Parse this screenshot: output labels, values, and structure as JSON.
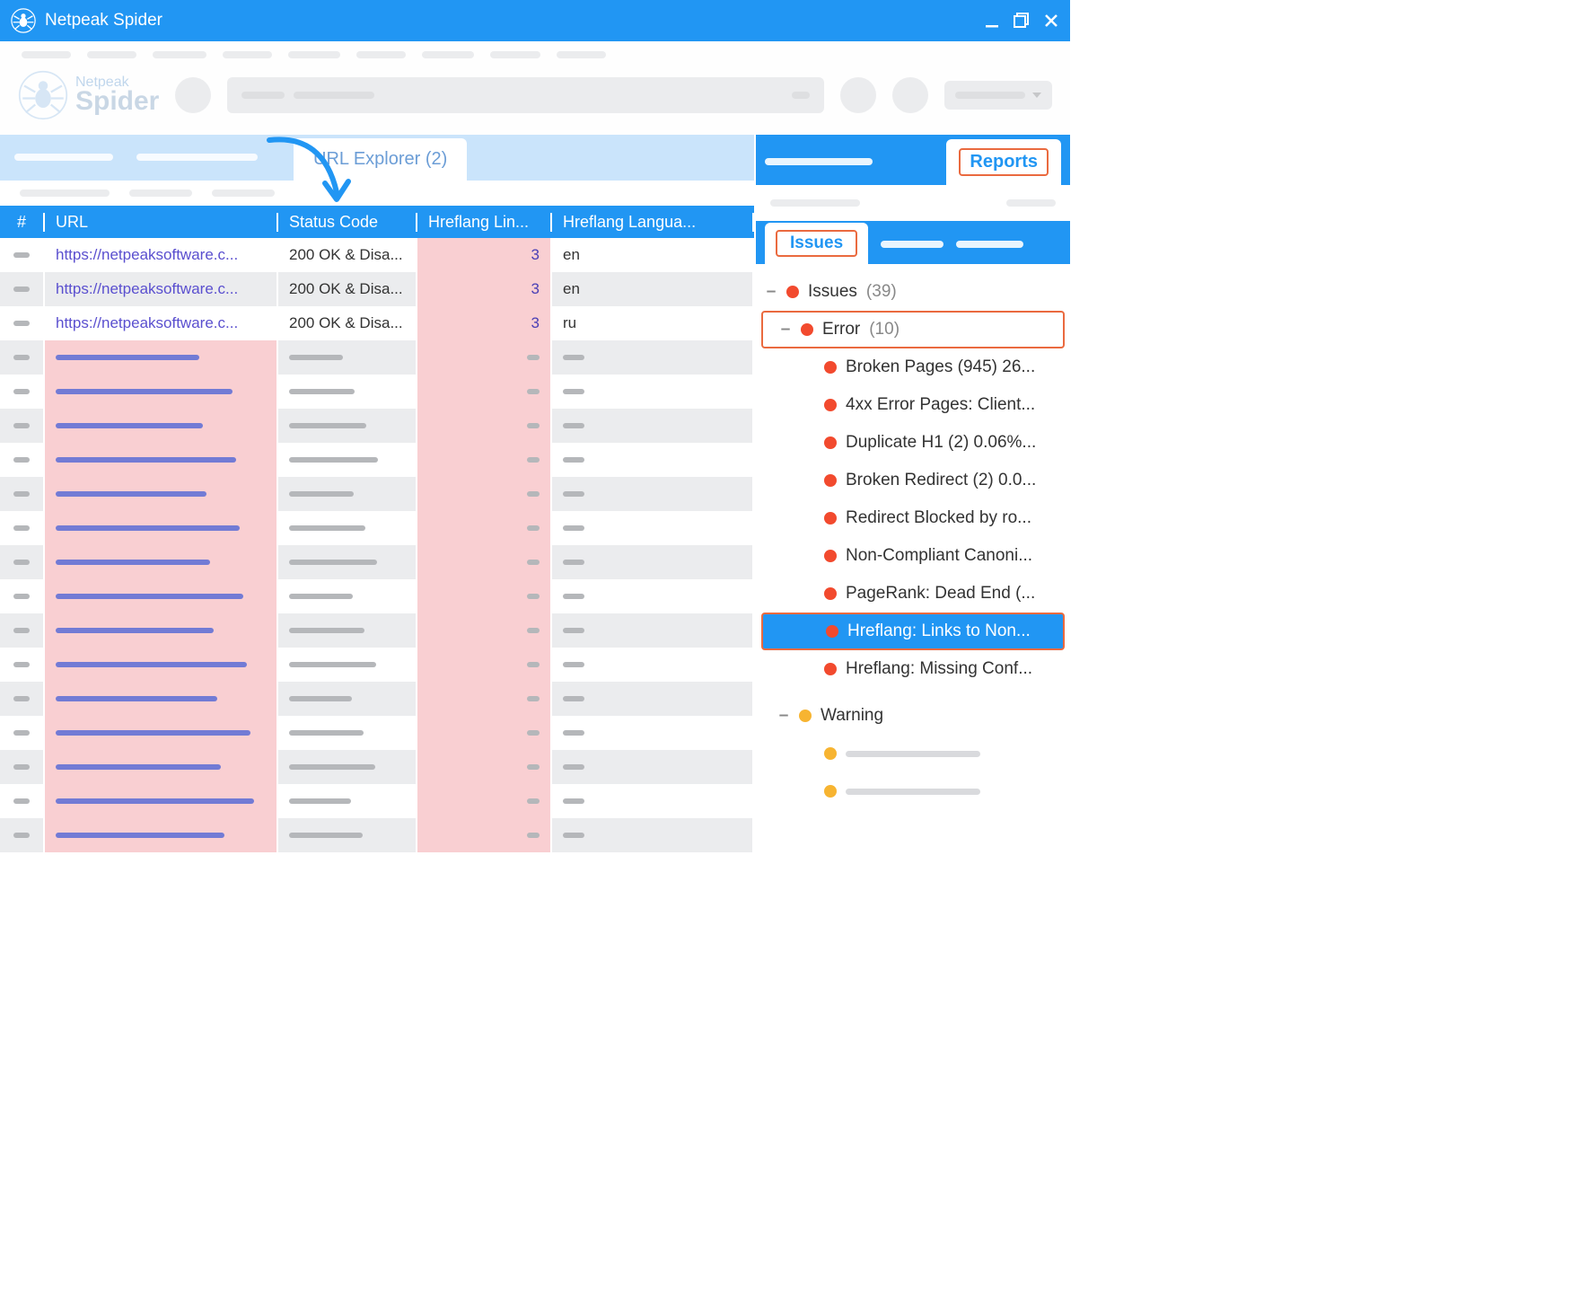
{
  "app": {
    "title": "Netpeak Spider",
    "brand1": "Netpeak",
    "brand2": "Spider"
  },
  "tabs": {
    "urlExplorer": "URL Explorer (2)"
  },
  "table": {
    "headers": {
      "idx": "#",
      "url": "URL",
      "status": "Status Code",
      "hlinks": "Hreflang Lin...",
      "hlang": "Hreflang Langua..."
    },
    "rows": [
      {
        "url": "https://netpeaksoftware.c...",
        "status": "200 OK & Disa...",
        "hlinks": "3",
        "hlang": "en",
        "rowStyle": "white"
      },
      {
        "url": "https://netpeaksoftware.c...",
        "status": "200 OK & Disa...",
        "hlinks": "3",
        "hlang": "en",
        "rowStyle": "grey"
      },
      {
        "url": "https://netpeaksoftware.c...",
        "status": "200 OK & Disa...",
        "hlinks": "3",
        "hlang": "ru",
        "rowStyle": "white"
      }
    ],
    "placeholderCount": 15
  },
  "rightPanel": {
    "reportsTab": "Reports",
    "issuesTab": "Issues",
    "root": {
      "label": "Issues",
      "count": "(39)"
    },
    "errorGroup": {
      "label": "Error",
      "count": "(10)"
    },
    "errors": [
      "Broken Pages (945) 26...",
      "4xx Error Pages: Client...",
      "Duplicate H1 (2) 0.06%...",
      "Broken Redirect (2) 0.0...",
      "Redirect Blocked by ro...",
      "Non-Compliant Canoni...",
      "PageRank: Dead End (...",
      "Hreflang: Links to Non...",
      "Hreflang: Missing Conf..."
    ],
    "selectedErrorIndex": 7,
    "warningGroup": {
      "label": "Warning"
    }
  }
}
